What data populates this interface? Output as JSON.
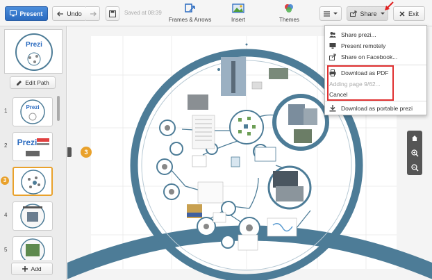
{
  "toolbar": {
    "present_label": "Present",
    "undo_label": "Undo",
    "saved_text": "Saved at 08:39",
    "frames_label": "Frames & Arrows",
    "insert_label": "Insert",
    "themes_label": "Themes",
    "share_label": "Share",
    "exit_label": "Exit"
  },
  "sidebar": {
    "edit_path_label": "Edit Path",
    "add_label": "Add",
    "overview_title": "Prezi",
    "slides": [
      {
        "num": "1",
        "title": "Prezi"
      },
      {
        "num": "2",
        "title": "Prezi"
      },
      {
        "num": "3",
        "title": ""
      },
      {
        "num": "4",
        "title": ""
      },
      {
        "num": "5",
        "title": ""
      }
    ],
    "active_badge": "3"
  },
  "canvas": {
    "step_badge": "3"
  },
  "share_menu": {
    "items": [
      {
        "label": "Share prezi...",
        "icon": "people-icon"
      },
      {
        "label": "Present remotely",
        "icon": "monitor-icon"
      },
      {
        "label": "Share on Facebook...",
        "icon": "share-icon"
      },
      {
        "label": "Download as PDF",
        "icon": "printer-icon"
      },
      {
        "label": "Adding page 9/62...",
        "icon": ""
      },
      {
        "label": "Cancel",
        "icon": ""
      },
      {
        "label": "Download as portable prezi",
        "icon": "download-icon"
      }
    ]
  },
  "colors": {
    "accent_blue": "#2b6bc0",
    "ring_blue": "#4d7c97",
    "highlight_red": "#e03030",
    "badge_orange": "#e9a12b"
  }
}
